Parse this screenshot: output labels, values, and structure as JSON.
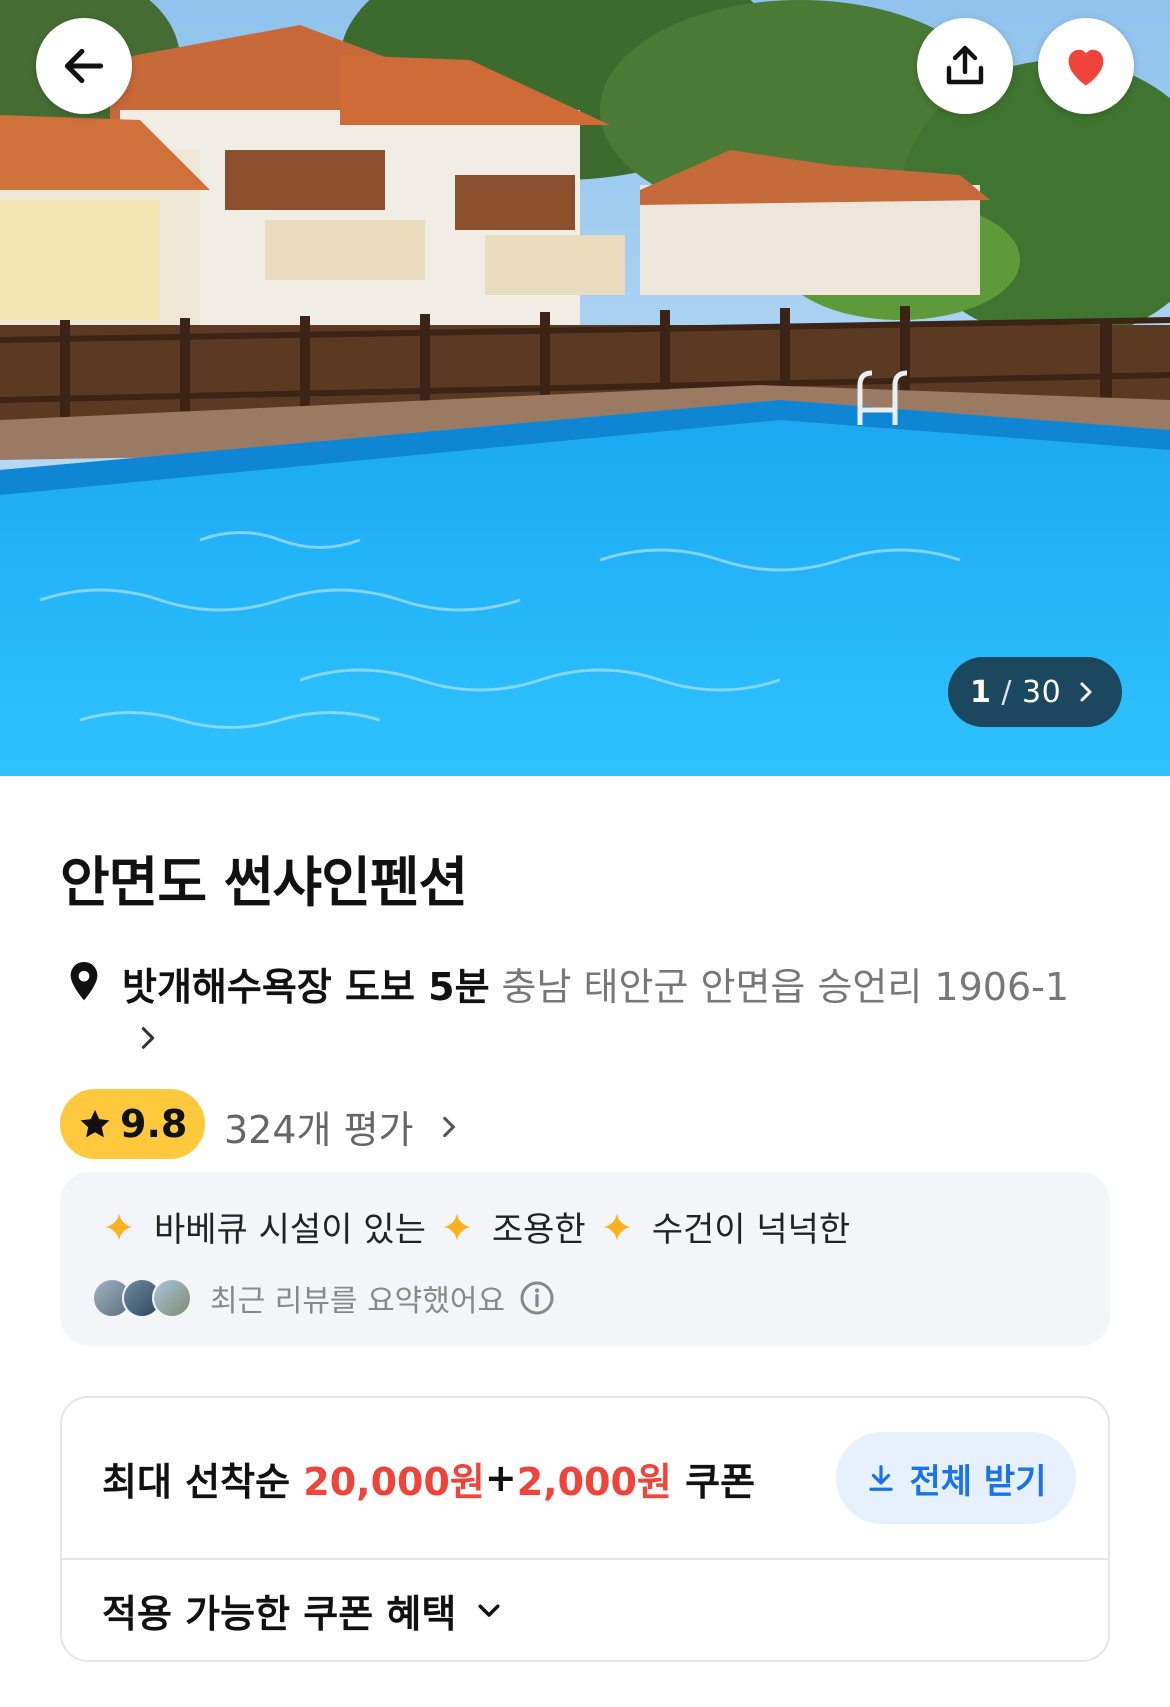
{
  "hero": {
    "photo_counter": {
      "current": "1",
      "separator": "/",
      "total": "30"
    },
    "icons": {
      "back": "arrow-left-icon",
      "share": "share-icon",
      "like": "heart-icon"
    },
    "colors": {
      "like_heart": "#f0443a"
    }
  },
  "property": {
    "name": "안면도 썬샤인펜션",
    "location": {
      "walk_info": "밧개해수욕장 도보 5분",
      "address": "충남 태안군 안면읍 승언리 1906-1"
    },
    "rating": {
      "score": "9.8",
      "review_count": "324개 평가"
    }
  },
  "review_summary": {
    "tags": [
      "바베큐 시설이 있는",
      "조용한",
      "수건이 넉넉한"
    ],
    "caption": "최근 리뷰를 요약했어요"
  },
  "coupon": {
    "prefix": "최대 선착순 ",
    "amount1": "20,000원",
    "plus": "+",
    "amount2": "2,000원",
    "suffix": " 쿠폰",
    "download_label": "전체 받기",
    "benefits_label": "적용 가능한 쿠폰 혜택"
  },
  "colors": {
    "rating_badge": "#ffc83d",
    "coupon_amount": "#f0443a",
    "download_button_text": "#1a73e8",
    "spark": "#ffb020"
  }
}
